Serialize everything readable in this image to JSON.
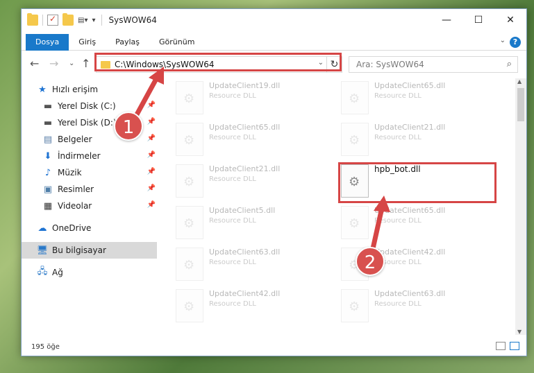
{
  "window": {
    "title": "SysWOW64"
  },
  "ribbon": {
    "tabs": [
      "Dosya",
      "Giriş",
      "Paylaş",
      "Görünüm"
    ]
  },
  "address": {
    "path": "C:\\Windows\\SysWOW64"
  },
  "search": {
    "placeholder": "Ara: SysWOW64"
  },
  "sidebar": {
    "items": [
      {
        "label": "Hızlı erişim",
        "icon": "star-icon",
        "pinned": false
      },
      {
        "label": "Yerel Disk (C:)",
        "icon": "drive-icon",
        "pinned": true
      },
      {
        "label": "Yerel Disk (D:)",
        "icon": "drive-icon",
        "pinned": true
      },
      {
        "label": "Belgeler",
        "icon": "documents-icon",
        "pinned": true
      },
      {
        "label": "İndirmeler",
        "icon": "download-icon",
        "pinned": true
      },
      {
        "label": "Müzik",
        "icon": "music-icon",
        "pinned": true
      },
      {
        "label": "Resimler",
        "icon": "pictures-icon",
        "pinned": true
      },
      {
        "label": "Videolar",
        "icon": "videos-icon",
        "pinned": true
      },
      {
        "label": "OneDrive",
        "icon": "cloud-icon",
        "pinned": false
      },
      {
        "label": "Bu bilgisayar",
        "icon": "computer-icon",
        "pinned": false,
        "selected": true
      },
      {
        "label": "Ağ",
        "icon": "network-icon",
        "pinned": false
      }
    ]
  },
  "files": {
    "col1": [
      {
        "name": "UpdateClient19.dll",
        "type": "Resource DLL"
      },
      {
        "name": "UpdateClient65.dll",
        "type": "Resource DLL"
      },
      {
        "name": "UpdateClient21.dll",
        "type": "Resource DLL"
      },
      {
        "name": "UpdateClient5.dll",
        "type": "Resource DLL"
      },
      {
        "name": "UpdateClient63.dll",
        "type": "Resource DLL"
      },
      {
        "name": "UpdateClient42.dll",
        "type": "Resource DLL"
      }
    ],
    "col2": [
      {
        "name": "UpdateClient65.dll",
        "type": "Resource DLL"
      },
      {
        "name": "UpdateClient21.dll",
        "type": "Resource DLL"
      },
      {
        "name": "hpb_bot.dll",
        "type": "",
        "highlighted": true
      },
      {
        "name": "UpdateClient65.dll",
        "type": "Resource DLL"
      },
      {
        "name": "UpdateClient42.dll",
        "type": "Resource DLL"
      },
      {
        "name": "UpdateClient63.dll",
        "type": "Resource DLL"
      }
    ]
  },
  "status": {
    "count": "195 öğe"
  },
  "annotations": {
    "badge1": "1",
    "badge2": "2",
    "accent": "#d64545"
  }
}
